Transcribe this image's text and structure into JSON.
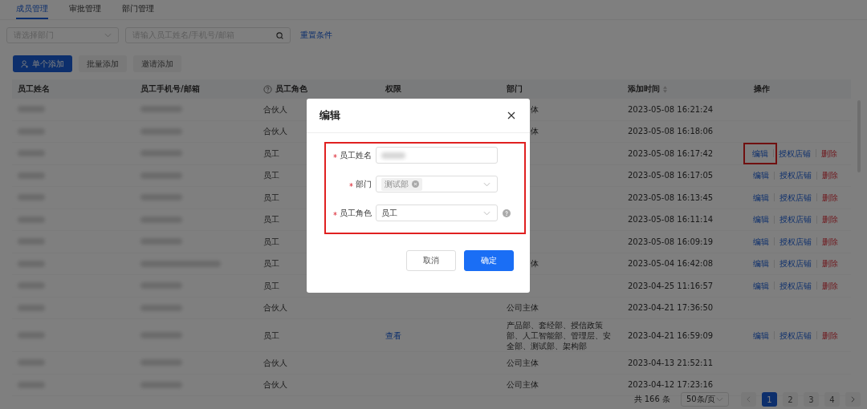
{
  "tabs": [
    {
      "label": "成员管理",
      "selected": true
    },
    {
      "label": "审批管理",
      "selected": false
    },
    {
      "label": "部门管理",
      "selected": false
    }
  ],
  "filters": {
    "department": {
      "placeholder": "请选择部门"
    },
    "search": {
      "placeholder": "请输入员工姓名/手机号/邮箱"
    },
    "reset": "重置条件"
  },
  "actions": [
    {
      "label": "单个添加",
      "kind": "primary"
    },
    {
      "label": "批量添加",
      "kind": "default"
    },
    {
      "label": "邀请添加",
      "kind": "default"
    }
  ],
  "table": {
    "columns": [
      {
        "label": "员工姓名"
      },
      {
        "label": "员工手机号/邮箱"
      },
      {
        "label": "员工角色",
        "kind": "help"
      },
      {
        "label": "权限"
      },
      {
        "label": "部门"
      },
      {
        "label": "添加时间",
        "kind": "sort"
      },
      {
        "label": "操作"
      }
    ],
    "rows": [
      {
        "role": "合伙人",
        "dept": "体",
        "dept_cut": true,
        "time": "2023-05-08 16:21:24"
      },
      {
        "role": "合伙人",
        "dept": "体",
        "dept_cut": true,
        "time": "2023-05-08 16:18:06"
      },
      {
        "role": "员工",
        "time": "2023-05-08 16:17:42",
        "ops": [
          {
            "label": "编辑",
            "kind": "link",
            "highlighted": true
          },
          {
            "label": "授权店铺",
            "kind": "link",
            "highlighted": false
          },
          {
            "label": "删除",
            "kind": "danger",
            "highlighted": false
          }
        ]
      },
      {
        "role": "员工",
        "time": "2023-05-08 16:17:05",
        "ops": [
          {
            "label": "编辑",
            "kind": "link",
            "highlighted": false
          },
          {
            "label": "授权店铺",
            "kind": "link",
            "highlighted": false
          },
          {
            "label": "删除",
            "kind": "danger",
            "highlighted": false
          }
        ]
      },
      {
        "role": "员工",
        "time": "2023-05-08 16:13:45",
        "ops": [
          {
            "label": "编辑",
            "kind": "link",
            "highlighted": false
          },
          {
            "label": "授权店铺",
            "kind": "link",
            "highlighted": false
          },
          {
            "label": "删除",
            "kind": "danger",
            "highlighted": false
          }
        ]
      },
      {
        "role": "员工",
        "time": "2023-05-08 16:11:14",
        "ops": [
          {
            "label": "编辑",
            "kind": "link",
            "highlighted": false
          },
          {
            "label": "授权店铺",
            "kind": "link",
            "highlighted": false
          },
          {
            "label": "删除",
            "kind": "danger",
            "highlighted": false
          }
        ]
      },
      {
        "role": "员工",
        "time": "2023-05-08 16:09:19",
        "ops": [
          {
            "label": "编辑",
            "kind": "link",
            "highlighted": false
          },
          {
            "label": "授权店铺",
            "kind": "link",
            "highlighted": false
          },
          {
            "label": "删除",
            "kind": "danger",
            "highlighted": false
          }
        ]
      },
      {
        "role": "员工",
        "dept": "体",
        "dept_cut": true,
        "time": "2023-05-04 16:42:08",
        "ops": [
          {
            "label": "编辑",
            "kind": "link",
            "highlighted": false
          },
          {
            "label": "授权店铺",
            "kind": "link",
            "highlighted": false
          },
          {
            "label": "删除",
            "kind": "danger",
            "highlighted": false
          }
        ]
      },
      {
        "role": "员工",
        "time": "2023-04-25 11:16:57",
        "ops": [
          {
            "label": "编辑",
            "kind": "link",
            "highlighted": false
          },
          {
            "label": "授权店铺",
            "kind": "link",
            "highlighted": false
          },
          {
            "label": "删除",
            "kind": "danger",
            "highlighted": false
          }
        ]
      },
      {
        "role": "合伙人",
        "dept": "公司主体",
        "time": "2023-04-21 17:36:50"
      },
      {
        "role": "员工",
        "permission": "查看",
        "dept": "产品部、套经部、授信政策部、人工智能部、管理层、安全部、测试部、架构部",
        "time": "2023-04-21 16:59:09",
        "ops": [
          {
            "label": "编辑",
            "kind": "link",
            "highlighted": false
          },
          {
            "label": "授权店铺",
            "kind": "link",
            "highlighted": false
          },
          {
            "label": "删除",
            "kind": "danger",
            "highlighted": false
          }
        ]
      },
      {
        "role": "合伙人",
        "dept": "公司主体",
        "time": "2023-04-13 21:52:11"
      },
      {
        "role": "合伙人",
        "dept": "公司主体",
        "time": "2023-04-12 17:23:16"
      }
    ]
  },
  "pagination": {
    "total": "共 166 条",
    "page_size": "50条/页",
    "pages": [
      {
        "label": "1",
        "selected": true
      },
      {
        "label": "2",
        "selected": false
      },
      {
        "label": "3",
        "selected": false
      },
      {
        "label": "4",
        "selected": false
      }
    ]
  },
  "dialog": {
    "title": "编辑",
    "form_highlighted": true,
    "fields": [
      {
        "label": "员工姓名",
        "required": true,
        "kind": "input",
        "help": false
      },
      {
        "label": "部门",
        "required": true,
        "kind": "tags",
        "tags": [
          "测试部"
        ],
        "help": false
      },
      {
        "label": "员工角色",
        "required": true,
        "kind": "select",
        "value": "员工",
        "help": true
      }
    ],
    "buttons": [
      {
        "label": "取消",
        "kind": "default"
      },
      {
        "label": "确定",
        "kind": "primary"
      }
    ]
  }
}
